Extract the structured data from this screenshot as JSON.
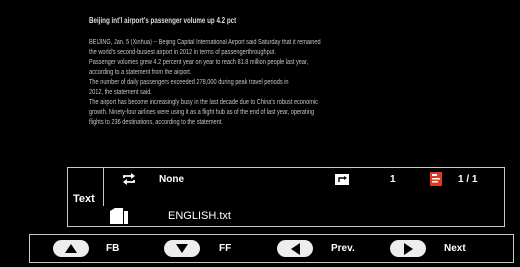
{
  "article": {
    "headline": "Beijing int'l airport's passenger volume up 4.2 pct",
    "lines": [
      "BEIJING, Jan. 5 (Xinhua) -- Beijing Capital International Airport said Saturday that it remained",
      "the world's second-busiest airport in 2012 in terms of passengerthroughput.",
      "Passenger volumes grew 4.2 percent year on year to reach 81.8 million people last year,",
      "according to a statement from the airport.",
      "The number of daily passengers exceeded 278,000 during peak travel periods in",
      "2012, the statement said.",
      "The airport has become increasingly busy in the last decade due to China's robust economic",
      "growth. Ninety-four airlines were using it as a flight hub as of the end of last year, operating",
      "flights to 236 destinations, according to the statement."
    ]
  },
  "panel": {
    "label": "Text",
    "repeat_icon": "repeat-icon",
    "repeat_value": "None",
    "return_icon": "return-icon",
    "page_current": "1",
    "book_icon": "book-icon",
    "page_indicator": "1 / 1",
    "file_icon": "file-icon",
    "file_name": "ENGLISH.txt"
  },
  "nav": {
    "fb": {
      "icon": "triangle-up-icon",
      "label": "FB"
    },
    "ff": {
      "icon": "triangle-down-icon",
      "label": "FF"
    },
    "prev": {
      "icon": "triangle-left-icon",
      "label": "Prev."
    },
    "next": {
      "icon": "triangle-right-icon",
      "label": "Next"
    }
  },
  "colors": {
    "background": "#000000",
    "border": "#c9c9c9",
    "button": "#ededed",
    "book_accent": "#e03a1e"
  }
}
